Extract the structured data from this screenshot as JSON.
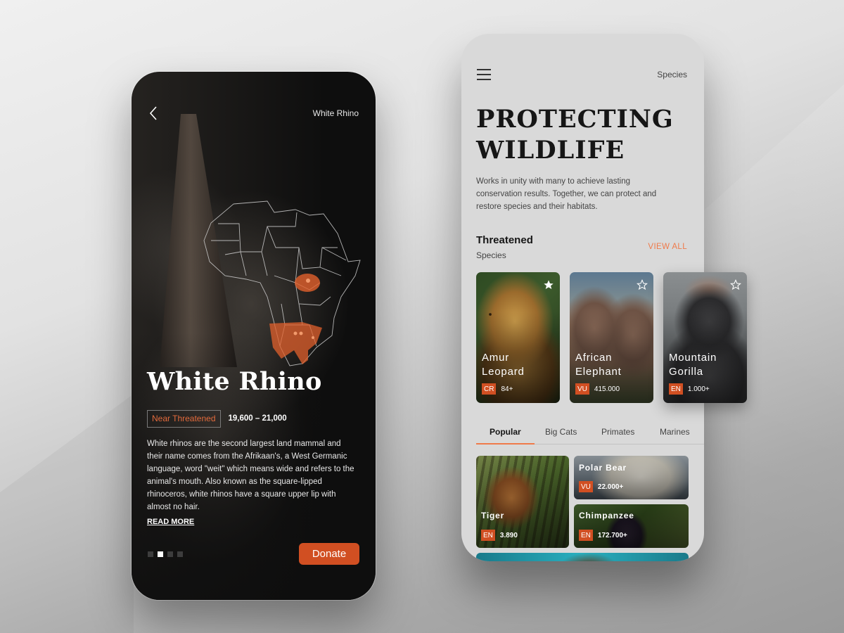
{
  "left_screen": {
    "header": {
      "back_icon": "chevron-left-icon",
      "title": "White Rhino"
    },
    "map": {
      "region": "Africa",
      "highlight_color": "#e2602c"
    },
    "species_name": "White Rhino",
    "status_badge": "Near Threatened",
    "population": "19,600 – 21,000",
    "description": "White rhinos are the second largest land mammal and their name comes from the Afrikaan's, a West Germanic language, word \"weit\" which means wide and refers to the animal's mouth. Also known as the square-lipped rhinoceros, white rhinos have a square upper lip with almost no hair.",
    "read_more_label": "READ MORE",
    "pager": {
      "count": 4,
      "active_index": 1
    },
    "donate_label": "Donate"
  },
  "right_screen": {
    "header": {
      "menu_icon": "hamburger-menu-icon",
      "nav_label": "Species"
    },
    "hero": {
      "title_line1": "PROTECTING",
      "title_line2": "WILDLIFE",
      "subtitle": "Works in unity with many to achieve lasting conservation results. Together, we can protect and restore species and their habitats."
    },
    "threatened_section": {
      "title": "Threatened",
      "subtitle": "Species",
      "view_all_label": "VIEW ALL",
      "cards": [
        {
          "name_line1": "Amur",
          "name_line2": "Leopard",
          "status": "CR",
          "count": "84+",
          "favorited": true
        },
        {
          "name_line1": "African",
          "name_line2": "Elephant",
          "status": "VU",
          "count": "415.000",
          "favorited": false
        },
        {
          "name_line1": "Mountain",
          "name_line2": "Gorilla",
          "status": "EN",
          "count": "1.000+",
          "favorited": false
        }
      ]
    },
    "tabs": [
      {
        "label": "Popular",
        "active": true
      },
      {
        "label": "Big Cats",
        "active": false
      },
      {
        "label": "Primates",
        "active": false
      },
      {
        "label": "Marines",
        "active": false
      }
    ],
    "popular": [
      {
        "name": "Tiger",
        "status": "EN",
        "count": "3.890"
      },
      {
        "name": "Polar Bear",
        "status": "VU",
        "count": "22.000+"
      },
      {
        "name": "Chimpanzee",
        "status": "EN",
        "count": "172.700+"
      }
    ]
  },
  "colors": {
    "accent": "#d14f22",
    "accent_light": "#ef7a4a",
    "dark_bg": "#0e0e0e",
    "light_bg": "#d9d9d9"
  }
}
